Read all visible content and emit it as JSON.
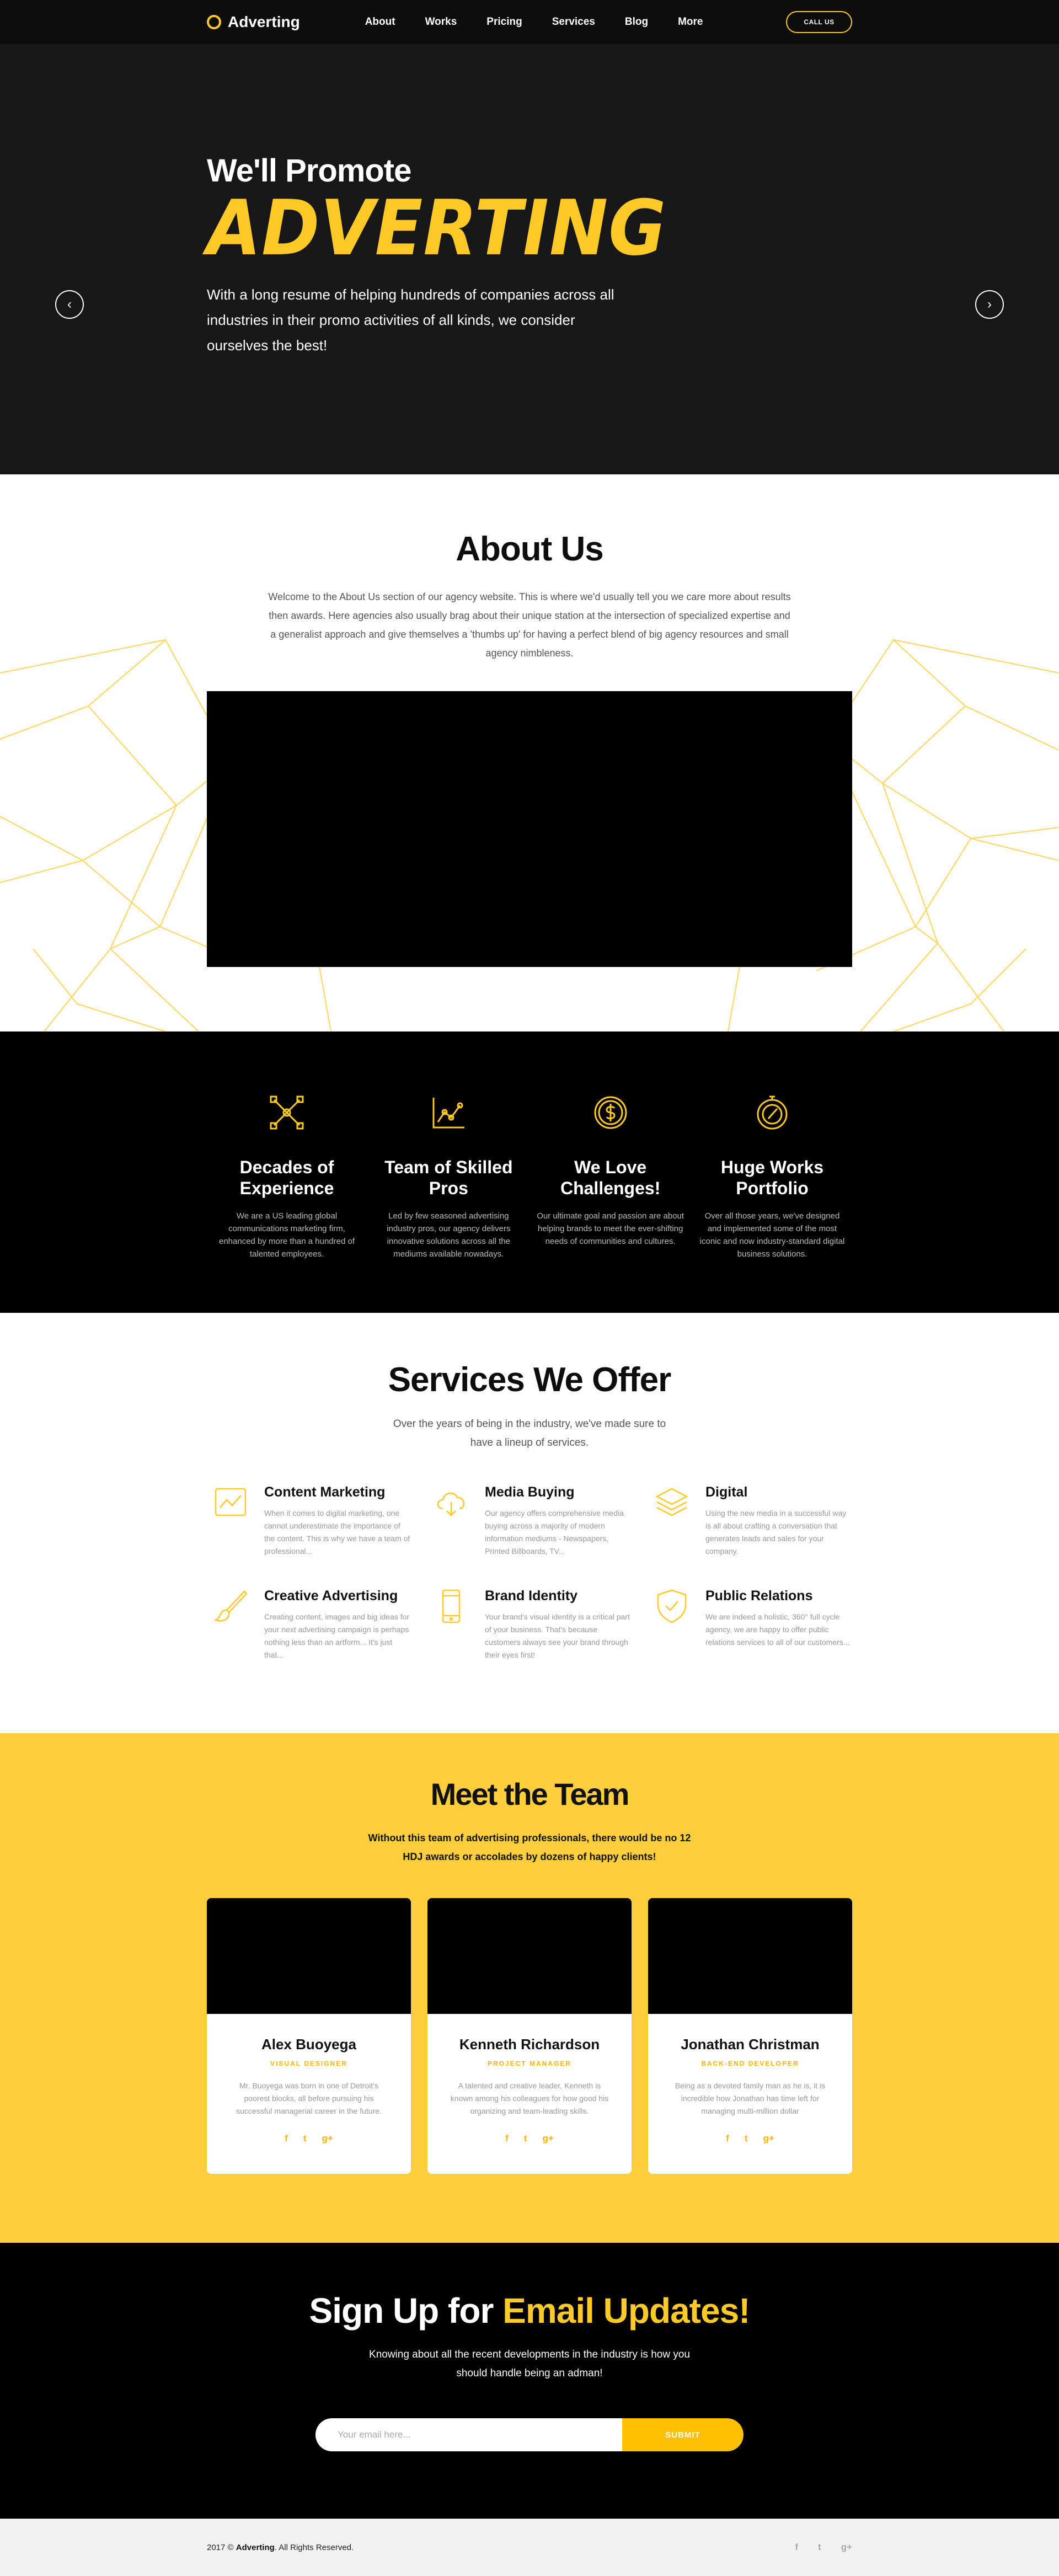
{
  "nav": {
    "brand": "Adverting",
    "menu": [
      "About",
      "Works",
      "Pricing",
      "Services",
      "Blog",
      "More"
    ],
    "cta": "CALL US"
  },
  "hero": {
    "subtitle": "We'll Promote",
    "brand": "ADVERTING",
    "text": "With a long resume of helping hundreds of companies across all industries in their promo activities of all kinds, we consider ourselves the best!",
    "prev_icon": "chevron-left-icon",
    "next_icon": "chevron-right-icon",
    "prev_glyph": "‹",
    "next_glyph": "›"
  },
  "about": {
    "title": "About Us",
    "text": "Welcome to the About Us section of our agency website. This is where we'd usually tell you we care more about results then awards. Here agencies also usually brag about their unique station at the intersection of specialized expertise and a generalist approach and give themselves a 'thumbs up' for having a perfect blend of big agency resources and small agency nimbleness."
  },
  "features": [
    {
      "icon": "vector-pen-icon",
      "title": "Decades of Experience",
      "text": "We are a US leading global communications marketing firm, enhanced by more than a hundred of talented employees."
    },
    {
      "icon": "line-chart-icon",
      "title": "Team of Skilled Pros",
      "text": "Led by few seasoned advertising industry pros, our agency delivers innovative solutions across all the mediums available nowadays."
    },
    {
      "icon": "dollar-coin-icon",
      "title": "We Love Challenges!",
      "text": "Our ultimate goal and passion are about helping brands to meet the ever-shifting needs of communities and cultures."
    },
    {
      "icon": "compass-icon",
      "title": "Huge Works Portfolio",
      "text": "Over all those years, we've designed and implemented some of the most iconic and now industry-standard digital business solutions."
    }
  ],
  "services": {
    "title": "Services We Offer",
    "intro": "Over the years of being in the industry, we've made sure to have a lineup of services.",
    "items": [
      {
        "icon": "chart-frame-icon",
        "title": "Content Marketing",
        "text": "When it comes to digital marketing, one cannot underestimate the importance of the content. This is why we have a team of professional..."
      },
      {
        "icon": "cloud-download-icon",
        "title": "Media Buying",
        "text": "Our agency offers comprehensive media buying across a majority of modern information mediums - Newspapers, Printed Billboards, TV..."
      },
      {
        "icon": "layers-icon",
        "title": "Digital",
        "text": "Using the new media in a successful way is all about crafting a conversation that generates leads and sales for your company."
      },
      {
        "icon": "brush-icon",
        "title": "Creative Advertising",
        "text": "Creating content, images and big ideas for your next advertising campaign is perhaps nothing less than an artform... It's just that..."
      },
      {
        "icon": "mobile-icon",
        "title": "Brand Identity",
        "text": "Your brand's visual identity is a critical part of your business. That's because customers always see your brand through their eyes first!"
      },
      {
        "icon": "shield-check-icon",
        "title": "Public Relations",
        "text": "We are indeed a holistic, 360° full cycle agency, we are happy to offer public relations services to all of our customers..."
      }
    ]
  },
  "team": {
    "title": "Meet the Team",
    "intro": "Without this team of advertising professionals, there would be no 12 HDJ awards or accolades by dozens of happy clients!",
    "members": [
      {
        "name": "Alex Buoyega",
        "role": "VISUAL DESIGNER",
        "text": "Mr. Buoyega was born in one of Detroit's poorest blocks, all before pursuing his successful managerial career in the future."
      },
      {
        "name": "Kenneth Richardson",
        "role": "PROJECT MANAGER",
        "text": "A talented and creative leader, Kenneth is known among his colleagues for how good his organizing and team-leading skills."
      },
      {
        "name": "Jonathan Christman",
        "role": "BACK-END DEVELOPER",
        "text": "Being as a devoted family man as he is, it is incredible how Jonathan has time left for managing multi-million dollar"
      }
    ],
    "social": [
      "f",
      "t",
      "g+"
    ]
  },
  "signup": {
    "title_a": "Sign Up for ",
    "title_b": "Email Updates!",
    "text": "Knowing about all the recent developments in the industry is how you should handle being an adman!",
    "placeholder": "Your email here...",
    "button": "SUBMIT"
  },
  "footer": {
    "copy_a": "2017 © ",
    "copy_brand": "Adverting",
    "copy_b": ". All Rights Reserved.",
    "social": [
      "f",
      "t",
      "g+"
    ]
  },
  "colors": {
    "accent": "#ffc926",
    "team_bg": "#ffce3d",
    "dark": "#0d0d0d"
  }
}
